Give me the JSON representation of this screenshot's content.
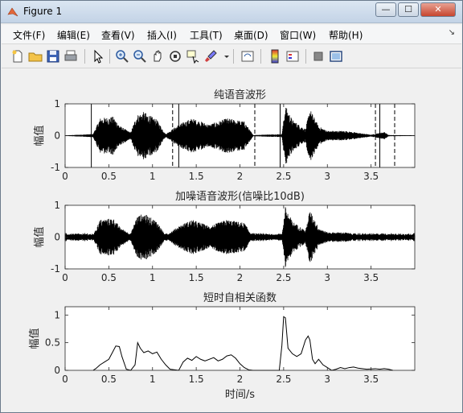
{
  "window": {
    "title": "Figure 1",
    "minimize": "—",
    "maximize": "☐",
    "close": "✕"
  },
  "menu": [
    "文件(F)",
    "编辑(E)",
    "查看(V)",
    "插入(I)",
    "工具(T)",
    "桌面(D)",
    "窗口(W)",
    "帮助(H)"
  ],
  "toolbar": [
    "new-figure-icon",
    "open-file-icon",
    "save-icon",
    "print-icon",
    "pointer-icon",
    "zoom-in-icon",
    "zoom-out-icon",
    "pan-icon",
    "rotate-3d-icon",
    "data-cursor-icon",
    "brush-icon",
    "link-plot-icon",
    "colorbar-icon",
    "legend-icon",
    "hide-plot-tools-icon",
    "show-plot-tools-icon"
  ],
  "chart_data": [
    {
      "type": "line",
      "title": "纯语音波形",
      "ylabel": "幅值",
      "xlabel": "",
      "xlim": [
        0,
        4
      ],
      "ylim": [
        -1,
        1
      ],
      "xticks": [
        0,
        0.5,
        1,
        1.5,
        2,
        2.5,
        3,
        3.5
      ],
      "yticks": [
        -1,
        0,
        1
      ],
      "solid_markers_s": [
        0.3,
        1.3,
        2.46,
        3.6
      ],
      "dashed_markers_s": [
        1.23,
        2.17,
        3.55,
        3.77
      ],
      "envelope": [
        {
          "x": 0.0,
          "amp": 0.01
        },
        {
          "x": 0.32,
          "amp": 0.05
        },
        {
          "x": 0.4,
          "amp": 0.55
        },
        {
          "x": 0.55,
          "amp": 0.6
        },
        {
          "x": 0.63,
          "amp": 0.3
        },
        {
          "x": 0.75,
          "amp": 0.1
        },
        {
          "x": 0.82,
          "amp": 0.65
        },
        {
          "x": 0.9,
          "amp": 0.75
        },
        {
          "x": 1.05,
          "amp": 0.5
        },
        {
          "x": 1.15,
          "amp": 0.05
        },
        {
          "x": 1.3,
          "amp": 0.35
        },
        {
          "x": 1.45,
          "amp": 0.55
        },
        {
          "x": 1.65,
          "amp": 0.35
        },
        {
          "x": 1.85,
          "amp": 0.55
        },
        {
          "x": 2.05,
          "amp": 0.45
        },
        {
          "x": 2.15,
          "amp": 0.02
        },
        {
          "x": 2.48,
          "amp": 0.05
        },
        {
          "x": 2.52,
          "amp": 0.95
        },
        {
          "x": 2.6,
          "amp": 0.5
        },
        {
          "x": 2.75,
          "amp": 0.2
        },
        {
          "x": 2.8,
          "amp": 0.85
        },
        {
          "x": 2.9,
          "amp": 0.3
        },
        {
          "x": 3.0,
          "amp": 0.15
        },
        {
          "x": 3.2,
          "amp": 0.15
        },
        {
          "x": 3.5,
          "amp": 0.03
        },
        {
          "x": 3.65,
          "amp": 0.12
        },
        {
          "x": 3.7,
          "amp": 0.02
        },
        {
          "x": 4.0,
          "amp": 0.01
        }
      ]
    },
    {
      "type": "line",
      "title": "加噪语音波形(信噪比10dB)",
      "ylabel": "幅值",
      "xlabel": "",
      "xlim": [
        0,
        4
      ],
      "ylim": [
        -1,
        1
      ],
      "xticks": [
        0,
        0.5,
        1,
        1.5,
        2,
        2.5,
        3,
        3.5
      ],
      "yticks": [
        -1,
        0,
        1
      ],
      "noise_floor": 0.12,
      "envelope": [
        {
          "x": 0.0,
          "amp": 0.01
        },
        {
          "x": 0.32,
          "amp": 0.05
        },
        {
          "x": 0.4,
          "amp": 0.55
        },
        {
          "x": 0.55,
          "amp": 0.6
        },
        {
          "x": 0.63,
          "amp": 0.3
        },
        {
          "x": 0.75,
          "amp": 0.1
        },
        {
          "x": 0.82,
          "amp": 0.65
        },
        {
          "x": 0.9,
          "amp": 0.75
        },
        {
          "x": 1.05,
          "amp": 0.5
        },
        {
          "x": 1.15,
          "amp": 0.05
        },
        {
          "x": 1.3,
          "amp": 0.35
        },
        {
          "x": 1.45,
          "amp": 0.55
        },
        {
          "x": 1.65,
          "amp": 0.35
        },
        {
          "x": 1.85,
          "amp": 0.55
        },
        {
          "x": 2.05,
          "amp": 0.45
        },
        {
          "x": 2.15,
          "amp": 0.02
        },
        {
          "x": 2.48,
          "amp": 0.05
        },
        {
          "x": 2.52,
          "amp": 0.95
        },
        {
          "x": 2.6,
          "amp": 0.5
        },
        {
          "x": 2.75,
          "amp": 0.2
        },
        {
          "x": 2.8,
          "amp": 0.85
        },
        {
          "x": 2.9,
          "amp": 0.3
        },
        {
          "x": 3.0,
          "amp": 0.15
        },
        {
          "x": 3.2,
          "amp": 0.15
        },
        {
          "x": 3.5,
          "amp": 0.03
        },
        {
          "x": 3.65,
          "amp": 0.12
        },
        {
          "x": 3.7,
          "amp": 0.02
        },
        {
          "x": 4.0,
          "amp": 0.01
        }
      ]
    },
    {
      "type": "line",
      "title": "短时自相关函数",
      "ylabel": "幅值",
      "xlabel": "时间/s",
      "xlim": [
        0,
        4
      ],
      "ylim": [
        0,
        1.15
      ],
      "xticks": [
        0,
        0.5,
        1,
        1.5,
        2,
        2.5,
        3,
        3.5
      ],
      "xticklabels": [
        "0",
        "0.5",
        "1",
        "1.5",
        "2",
        "2.5",
        "3",
        "3.5"
      ],
      "yticks": [
        0,
        0.5,
        1
      ],
      "yticklabels": [
        "0",
        "0.5",
        "1"
      ],
      "x": [
        0.32,
        0.35,
        0.4,
        0.45,
        0.5,
        0.55,
        0.58,
        0.62,
        0.65,
        0.7,
        0.75,
        0.8,
        0.83,
        0.86,
        0.9,
        0.95,
        1.0,
        1.05,
        1.1,
        1.15,
        1.2,
        1.3,
        1.35,
        1.4,
        1.45,
        1.5,
        1.55,
        1.6,
        1.7,
        1.75,
        1.8,
        1.85,
        1.9,
        1.95,
        2.0,
        2.05,
        2.1,
        2.15,
        2.2,
        2.45,
        2.48,
        2.5,
        2.52,
        2.55,
        2.6,
        2.65,
        2.7,
        2.75,
        2.78,
        2.8,
        2.83,
        2.86,
        2.9,
        2.95,
        3.0,
        3.05,
        3.1,
        3.15,
        3.2,
        3.25,
        3.3,
        3.35,
        3.45,
        3.55,
        3.6,
        3.65,
        3.7,
        3.75
      ],
      "y": [
        0.0,
        0.03,
        0.1,
        0.15,
        0.2,
        0.35,
        0.44,
        0.43,
        0.25,
        0.02,
        0.0,
        0.1,
        0.5,
        0.4,
        0.32,
        0.35,
        0.3,
        0.33,
        0.2,
        0.1,
        0.02,
        0.0,
        0.15,
        0.22,
        0.18,
        0.25,
        0.2,
        0.17,
        0.23,
        0.17,
        0.2,
        0.26,
        0.28,
        0.22,
        0.12,
        0.05,
        0.01,
        0.0,
        0.0,
        0.0,
        0.45,
        0.97,
        0.95,
        0.4,
        0.3,
        0.25,
        0.3,
        0.55,
        0.62,
        0.55,
        0.2,
        0.12,
        0.2,
        0.1,
        0.05,
        0.0,
        0.02,
        0.05,
        0.03,
        0.05,
        0.06,
        0.04,
        0.02,
        0.03,
        0.02,
        0.03,
        0.02,
        0.0
      ]
    }
  ]
}
